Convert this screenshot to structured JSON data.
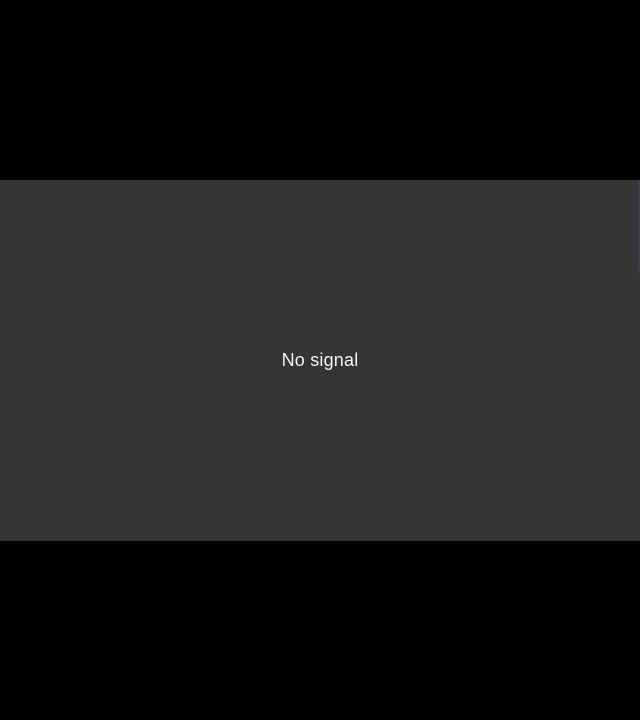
{
  "video": {
    "status_text": "No signal"
  },
  "colors": {
    "letterbox": "#000000",
    "panel_background": "#353535",
    "status_text": "#f2f2f2"
  }
}
